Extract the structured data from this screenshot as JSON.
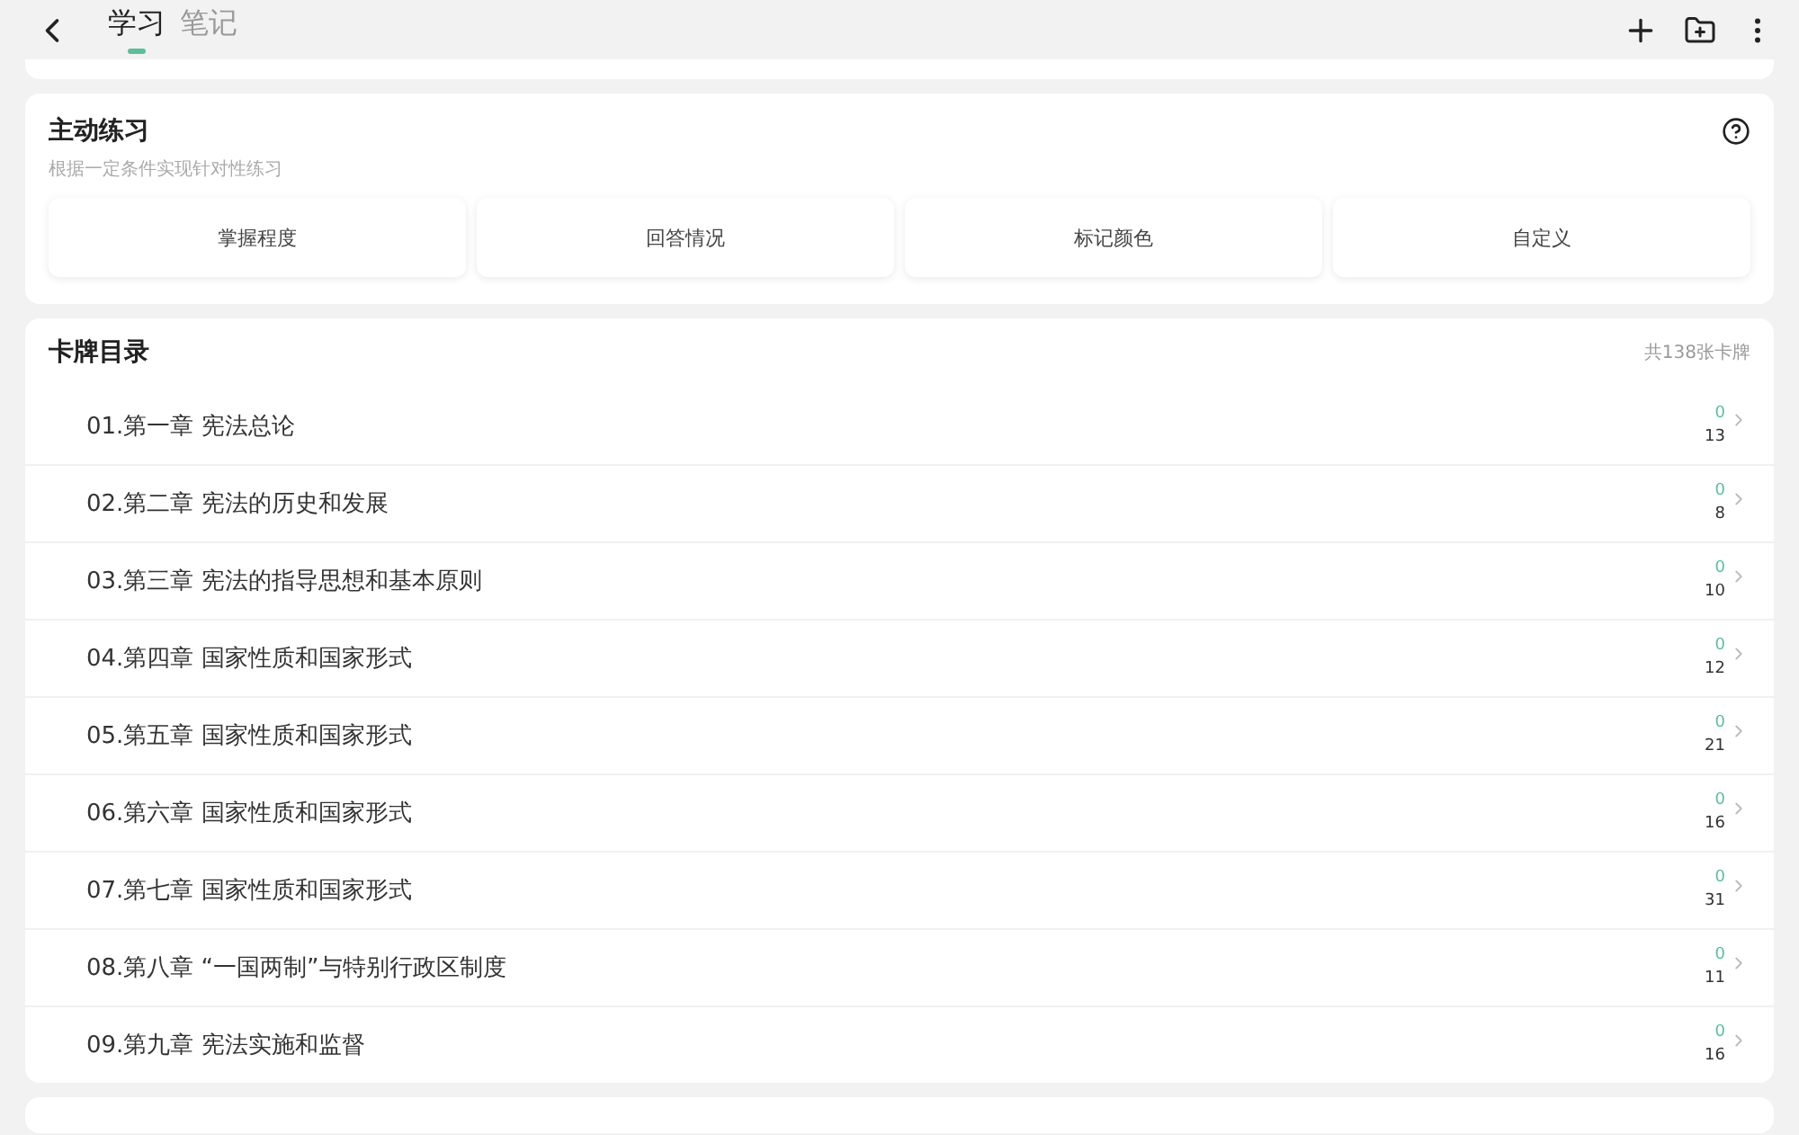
{
  "header": {
    "tabs": [
      {
        "label": "学习",
        "selected": true
      },
      {
        "label": "笔记",
        "selected": false
      }
    ]
  },
  "practice": {
    "title": "主动练习",
    "subtitle": "根据一定条件实现针对性练习",
    "options": [
      "掌握程度",
      "回答情况",
      "标记颜色",
      "自定义"
    ]
  },
  "catalog": {
    "title": "卡牌目录",
    "total": "共138张卡牌",
    "chapters": [
      {
        "title": "01.第一章 宪法总论",
        "due": "0",
        "count": "13"
      },
      {
        "title": "02.第二章 宪法的历史和发展",
        "due": "0",
        "count": "8"
      },
      {
        "title": "03.第三章 宪法的指导思想和基本原则",
        "due": "0",
        "count": "10"
      },
      {
        "title": "04.第四章 国家性质和国家形式",
        "due": "0",
        "count": "12"
      },
      {
        "title": "05.第五章 国家性质和国家形式",
        "due": "0",
        "count": "21"
      },
      {
        "title": "06.第六章 国家性质和国家形式",
        "due": "0",
        "count": "16"
      },
      {
        "title": "07.第七章 国家性质和国家形式",
        "due": "0",
        "count": "31"
      },
      {
        "title": "08.第八章 “一国两制”与特别行政区制度",
        "due": "0",
        "count": "11"
      },
      {
        "title": "09.第九章 宪法实施和监督",
        "due": "0",
        "count": "16"
      }
    ]
  }
}
